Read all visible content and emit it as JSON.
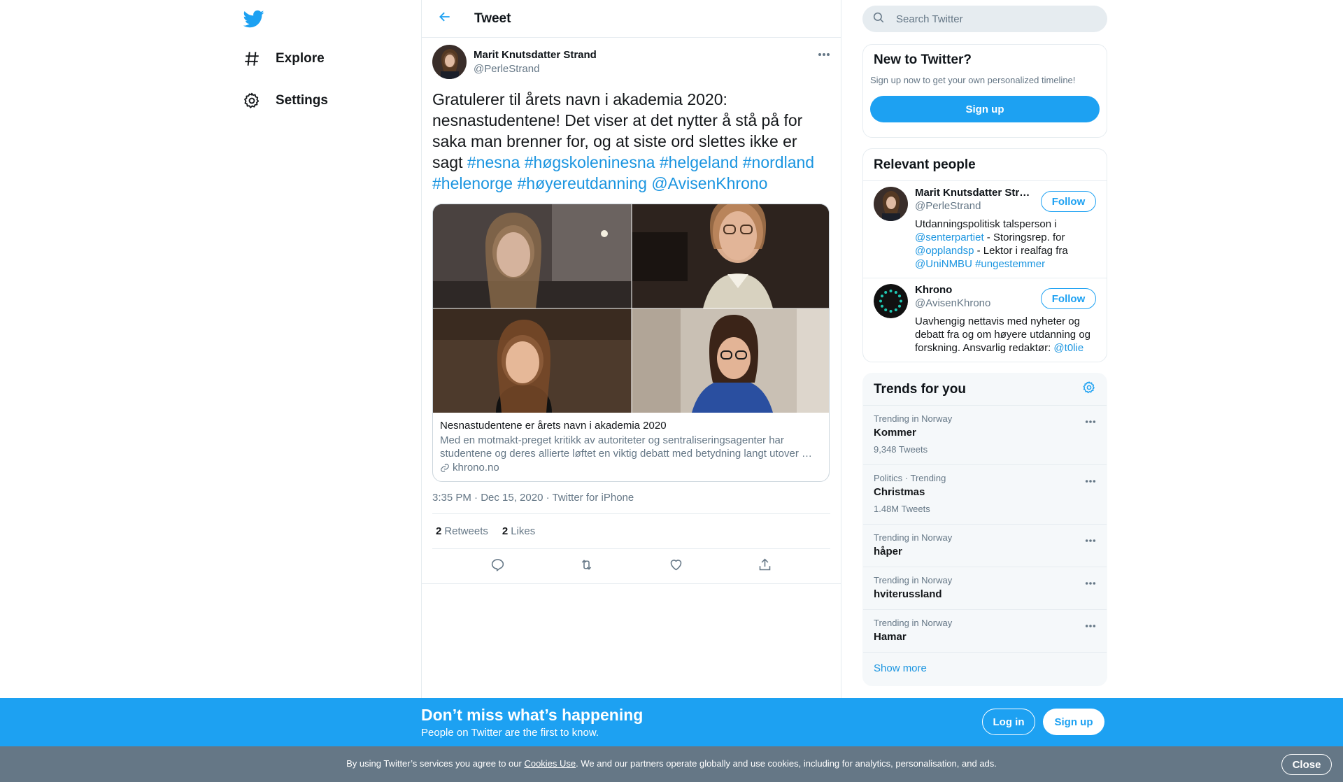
{
  "nav": {
    "logo_icon": "twitter-bird-icon",
    "items": [
      {
        "label": "Explore",
        "icon": "hashtag-icon"
      },
      {
        "label": "Settings",
        "icon": "gear-icon"
      }
    ]
  },
  "header": {
    "title": "Tweet",
    "back_icon": "arrow-left-icon"
  },
  "tweet": {
    "author_name": "Marit Knutsdatter Strand",
    "author_handle": "@PerleStrand",
    "text_plain": "Gratulerer til årets navn i akademia 2020: nesnastudentene! Det viser at det nytter å stå på for saka man brenner for, og at siste ord slettes ikke er sagt",
    "hashtags": [
      "#nesna",
      "#høgskoleninesna",
      "#helgeland",
      "#nordland",
      "#helenorge",
      "#høyereutdanning"
    ],
    "mention": "@AvisenKhrono",
    "card": {
      "title": "Nesnastudentene er årets navn i akademia 2020",
      "description": "Med en motmakt-preget kritikk av autoriteter og sentraliseringsagenter har studentene og deres allierte løftet en viktig debatt med betydning langt utover …",
      "domain": "khrono.no"
    },
    "time": "3:35 PM · Dec 15, 2020",
    "separator": " · ",
    "source": "Twitter for iPhone",
    "retweets_count": "2",
    "retweets_label": "Retweets",
    "likes_count": "2",
    "likes_label": "Likes"
  },
  "search": {
    "placeholder": "Search Twitter"
  },
  "new_to_twitter": {
    "title": "New to Twitter?",
    "subtitle": "Sign up now to get your own personalized timeline!",
    "button": "Sign up"
  },
  "relevant": {
    "title": "Relevant people",
    "people": [
      {
        "name": "Marit Knutsdatter Strand",
        "handle": "@PerleStrand",
        "follow": "Follow",
        "bio_1": "Utdanningspolitisk talsperson i ",
        "bio_link_1": "@senterpartiet",
        "bio_2": " - Storingsrep. for ",
        "bio_link_2": "@opplandsp",
        "bio_3": " - Lektor i realfag fra ",
        "bio_link_3": "@UniNMBU",
        "bio_4": " ",
        "bio_link_4": "#ungestemmer"
      },
      {
        "name": "Khrono",
        "handle": "@AvisenKhrono",
        "follow": "Follow",
        "bio_1": "Uavhengig nettavis med nyheter og debatt fra og om høyere utdanning og forskning. Ansvarlig redaktør: ",
        "bio_link_1": "@t0lie"
      }
    ]
  },
  "trends": {
    "title": "Trends for you",
    "items": [
      {
        "context": "Trending in Norway",
        "name": "Kommer",
        "count": "9,348 Tweets"
      },
      {
        "context": "Politics · Trending",
        "name": "Christmas",
        "count": "1.48M Tweets"
      },
      {
        "context": "Trending in Norway",
        "name": "håper",
        "count": ""
      },
      {
        "context": "Trending in Norway",
        "name": "hviterussland",
        "count": ""
      },
      {
        "context": "Trending in Norway",
        "name": "Hamar",
        "count": ""
      }
    ],
    "show_more": "Show more"
  },
  "banner": {
    "title": "Don’t miss what’s happening",
    "subtitle": "People on Twitter are the first to know.",
    "login": "Log in",
    "signup": "Sign up"
  },
  "cookie": {
    "text_1": "By using Twitter’s services you agree to our ",
    "link": "Cookies Use",
    "text_2": ". We and our partners operate globally and use cookies, including for analytics, personalisation, and ads.",
    "close": "Close"
  },
  "colors": {
    "accent": "#1da1f2",
    "link": "#1b95e0",
    "secondary_text": "#657786",
    "cookie_bg": "#657786"
  }
}
